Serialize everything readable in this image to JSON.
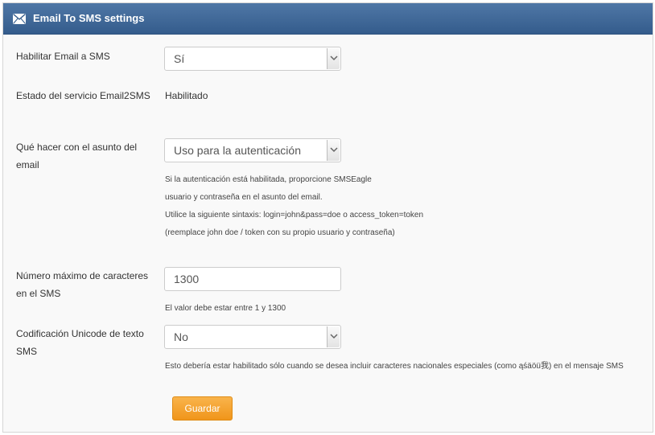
{
  "header": {
    "title": "Email To SMS settings",
    "icon": "envelope-icon"
  },
  "form": {
    "enable": {
      "label": "Habilitar Email a SMS",
      "value": "Sí"
    },
    "status": {
      "label": "Estado del servicio Email2SMS",
      "value": "Habilitado"
    },
    "subject": {
      "label_line1": "Qué hacer con el asunto del",
      "label_line2": "email",
      "value": "Uso para la autenticación",
      "help": [
        "Si la autenticación está habilitada, proporcione SMSEagle",
        "usuario y contraseña en el asunto del email.",
        "Utilice la siguiente sintaxis: login=john&pass=doe o access_token=token",
        "(reemplace john doe / token con su propio usuario y contraseña)"
      ]
    },
    "max_chars": {
      "label_line1": "Número máximo de caracteres",
      "label_line2": "en el SMS",
      "value": "1300",
      "help": "El valor debe estar entre 1 y 1300"
    },
    "unicode": {
      "label_line1": "Codificación Unicode de texto",
      "label_line2": "SMS",
      "value": "No",
      "help": "Esto debería estar habilitado sólo cuando se desea incluir caracteres nacionales especiales (como ąśäöü我) en el mensaje SMS"
    },
    "save_label": "Guardar"
  }
}
